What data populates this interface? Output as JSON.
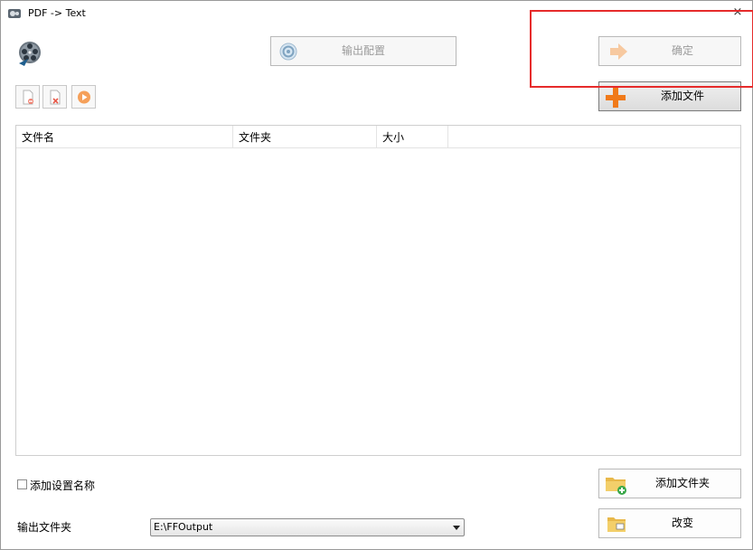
{
  "window": {
    "title": "PDF -> Text",
    "close_glyph": "×"
  },
  "toolbar": {
    "output_config_label": "输出配置",
    "ok_label": "确定",
    "add_file_label": "添加文件"
  },
  "file_list": {
    "columns": [
      "文件名",
      "文件夹",
      "大小"
    ]
  },
  "options": {
    "add_setting_name_label": "添加设置名称",
    "add_setting_name_checked": false
  },
  "output": {
    "folder_label": "输出文件夹",
    "folder_value": "E:\\FFOutput",
    "add_folder_label": "添加文件夹",
    "change_label": "改变"
  },
  "colors": {
    "highlight": "#e62b2b",
    "accent_orange": "#f07a1a"
  },
  "icons": [
    "app-icon",
    "film-reel-icon",
    "gear-icon",
    "arrow-right-icon",
    "plus-icon",
    "file-remove-icon",
    "file-delete-icon",
    "play-icon",
    "folder-add-icon",
    "folder-change-icon"
  ]
}
